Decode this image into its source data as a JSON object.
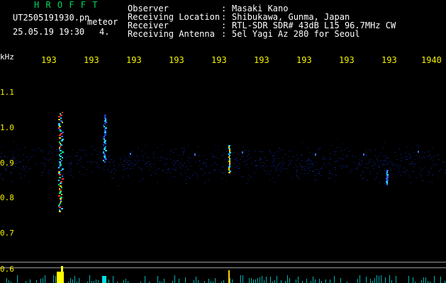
{
  "header": {
    "brand": "H R O F F T",
    "filename": "UT2505191930.pn",
    "classification": "meteor",
    "datetime": "25.05.19 19:30",
    "counter": "4.",
    "fields": [
      {
        "label": "Observer",
        "value": "Masaki Kano"
      },
      {
        "label": "Receiving Location",
        "value": "Shibukawa, Gunma, Japan"
      },
      {
        "label": "Receiver",
        "value": "RTL-SDR SDR# 43dB L15 96.7MHz CW"
      },
      {
        "label": "Receiving Antenna",
        "value": "5el Yagi Az 280 for Seoul"
      }
    ]
  },
  "axes": {
    "y_unit": "kHz",
    "y_ticks": [
      "1.1",
      "1.0",
      "0.9",
      "0.8",
      "0.7",
      "0.6"
    ],
    "x_ticks": [
      "193",
      "193",
      "193",
      "193",
      "193",
      "193",
      "193",
      "193",
      "193",
      "1940"
    ]
  },
  "colors": {
    "background": "#000000",
    "brand": "#00d85a",
    "text": "#ffffff",
    "tick_labels": "#f4f000",
    "noise": "#0a1a6a",
    "meteor_hot": "#ff3030",
    "meteor_mid": "#2ad0ff",
    "power_trace": "#00e0e0",
    "power_peak": "#ffff00"
  }
}
